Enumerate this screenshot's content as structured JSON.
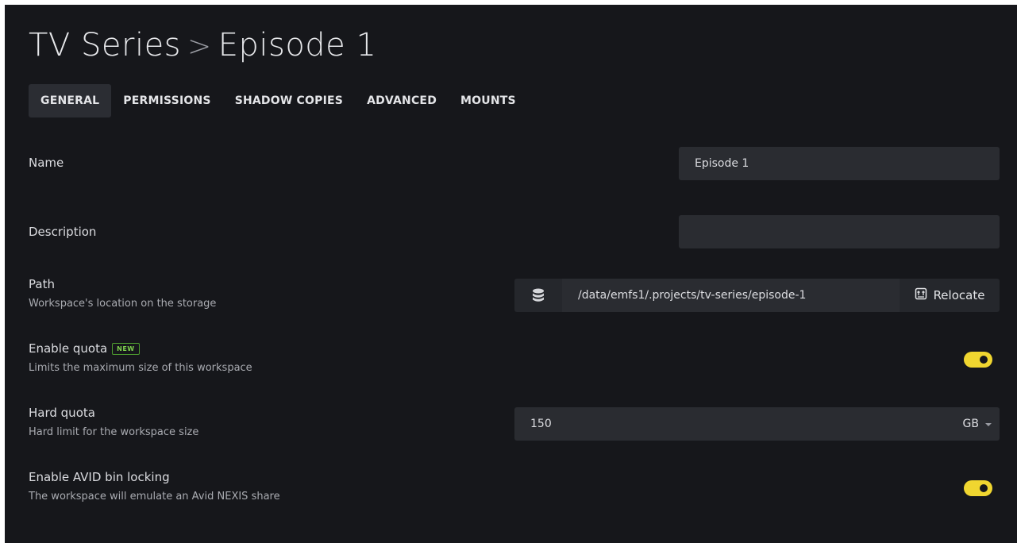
{
  "header": {
    "parent": "TV Series",
    "separator": ">",
    "current": "Episode 1"
  },
  "tabs": [
    {
      "label": "GENERAL",
      "active": true
    },
    {
      "label": "PERMISSIONS",
      "active": false
    },
    {
      "label": "SHADOW COPIES",
      "active": false
    },
    {
      "label": "ADVANCED",
      "active": false
    },
    {
      "label": "MOUNTS",
      "active": false
    }
  ],
  "form": {
    "name": {
      "label": "Name",
      "value": "Episode 1"
    },
    "description": {
      "label": "Description",
      "value": ""
    },
    "path": {
      "label": "Path",
      "sub": "Workspace's location on the storage",
      "value": "/data/emfs1/.projects/tv-series/episode-1",
      "icon": "database-icon",
      "relocate_label": "Relocate",
      "relocate_icon": "relocate-icon"
    },
    "quota": {
      "label": "Enable quota",
      "badge": "NEW",
      "sub": "Limits the maximum size of this workspace",
      "enabled": true
    },
    "hard_quota": {
      "label": "Hard quota",
      "sub": "Hard limit for the workspace size",
      "value": "150",
      "unit": "GB"
    },
    "avid": {
      "label": "Enable AVID bin locking",
      "sub": "The workspace will emulate an Avid NEXIS share",
      "enabled": true
    }
  },
  "colors": {
    "background": "#16171b",
    "field": "#2a2c31",
    "toggle_on": "#f0d630",
    "badge_green": "#7fd14f"
  }
}
